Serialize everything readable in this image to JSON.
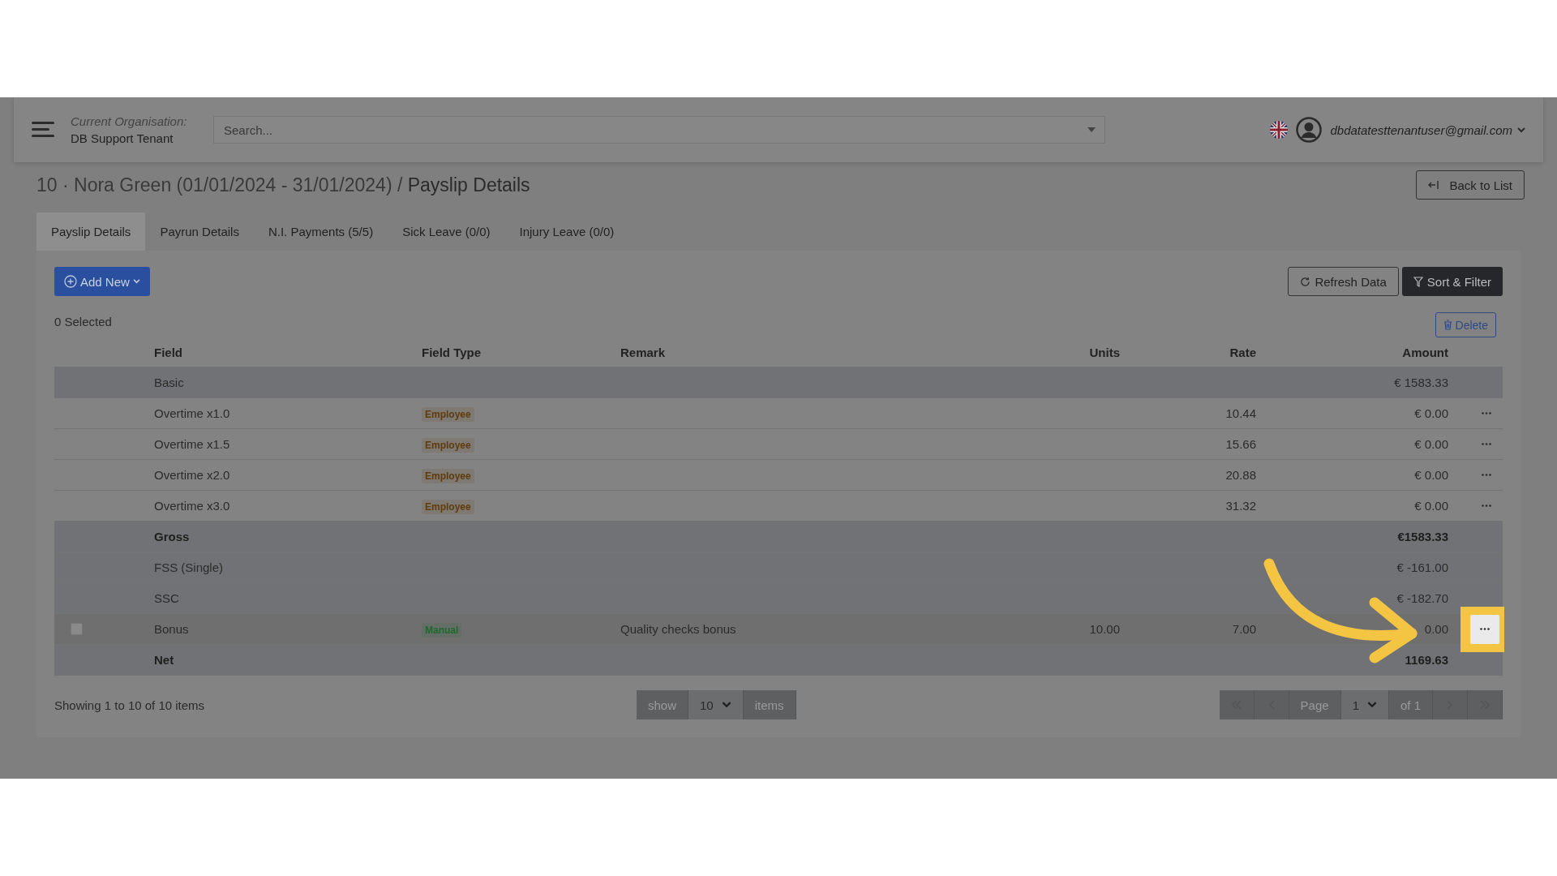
{
  "header": {
    "organisation_label": "Current Organisation:",
    "organisation": "DB Support Tenant",
    "search": {
      "placeholder": "Search..."
    },
    "user": "dbdatatesttenantuser@gmail.com"
  },
  "page_title": {
    "prefix": "10 · Nora Green (01/01/2024 - 31/01/2024) /",
    "current": "Payslip Details"
  },
  "back_button": "Back to List",
  "tabs": [
    {
      "label": "Payslip Details",
      "selected": true
    },
    {
      "label": "Payrun Details",
      "selected": false
    },
    {
      "label": "N.I. Payments (5/5)",
      "selected": false
    },
    {
      "label": "Sick Leave (0/0)",
      "selected": false
    },
    {
      "label": "Injury Leave (0/0)",
      "selected": false
    }
  ],
  "toolbar": {
    "add_new": "Add New",
    "refresh": "Refresh Data",
    "sort_filter": "Sort & Filter",
    "selected_count": "0 Selected",
    "delete": "Delete"
  },
  "table": {
    "columns": [
      "Field",
      "Field Type",
      "Remark",
      "Units",
      "Rate",
      "Amount"
    ],
    "rows": [
      {
        "field": "Basic",
        "bold": false,
        "shaded": true,
        "amount": "€ 1583.33",
        "menu": false,
        "checkbox": false,
        "highlighted": false
      },
      {
        "field": "Overtime x1.0",
        "bold": false,
        "shaded": false,
        "type": {
          "label": "Employee",
          "color": "#5e3c0c"
        },
        "rate": "10.44",
        "amount": "€ 0.00",
        "menu": true,
        "checkbox": false,
        "highlighted": false
      },
      {
        "field": "Overtime x1.5",
        "bold": false,
        "shaded": false,
        "type": {
          "label": "Employee",
          "color": "#5e3c0c"
        },
        "rate": "15.66",
        "amount": "€ 0.00",
        "menu": true,
        "checkbox": false,
        "highlighted": false
      },
      {
        "field": "Overtime x2.0",
        "bold": false,
        "shaded": false,
        "type": {
          "label": "Employee",
          "color": "#5e3c0c"
        },
        "rate": "20.88",
        "amount": "€ 0.00",
        "menu": true,
        "checkbox": false,
        "highlighted": false
      },
      {
        "field": "Overtime x3.0",
        "bold": false,
        "shaded": false,
        "type": {
          "label": "Employee",
          "color": "#5e3c0c"
        },
        "rate": "31.32",
        "amount": "€ 0.00",
        "menu": true,
        "checkbox": false,
        "highlighted": false
      },
      {
        "field": "Gross",
        "bold": true,
        "shaded": true,
        "amount": "€1583.33",
        "menu": false,
        "checkbox": false,
        "highlighted": false
      },
      {
        "field": "FSS (Single)",
        "bold": false,
        "shaded": true,
        "amount": "€ -161.00",
        "menu": false,
        "checkbox": false,
        "highlighted": false
      },
      {
        "field": "SSC",
        "bold": false,
        "shaded": true,
        "amount": "€ -182.70",
        "menu": false,
        "checkbox": false,
        "highlighted": false
      },
      {
        "field": "Bonus",
        "bold": false,
        "shaded": true,
        "type": {
          "label": "Manual",
          "color": "#1c6a2c"
        },
        "remark": "Quality checks bonus",
        "units": "10.00",
        "rate": "7.00",
        "amount": "0.00",
        "menu": true,
        "checkbox": true,
        "highlighted": true
      },
      {
        "field": "Net",
        "bold": true,
        "shaded": true,
        "amount": "1169.63",
        "menu": false,
        "checkbox": false,
        "highlighted": false
      }
    ]
  },
  "footer": {
    "showing": "Showing 1 to 10 of 10 items",
    "show": "show",
    "page_size": "10",
    "items": "items",
    "page_label": "Page",
    "page": "1",
    "page_of": "of 1"
  }
}
